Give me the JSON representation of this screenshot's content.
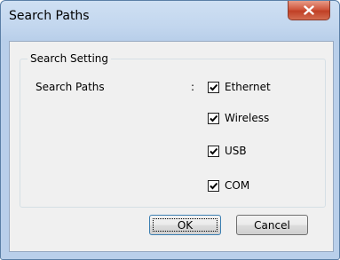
{
  "window": {
    "title": "Search Paths"
  },
  "group": {
    "title": "Search Setting",
    "row_label": "Search Paths",
    "separator": ":"
  },
  "options": [
    {
      "label": "Ethernet",
      "checked": true
    },
    {
      "label": "Wireless",
      "checked": true
    },
    {
      "label": "USB",
      "checked": true
    },
    {
      "label": "COM",
      "checked": true
    }
  ],
  "buttons": {
    "ok": "OK",
    "cancel": "Cancel"
  },
  "icons": {
    "close": "close-icon",
    "check": "checkmark-icon"
  }
}
